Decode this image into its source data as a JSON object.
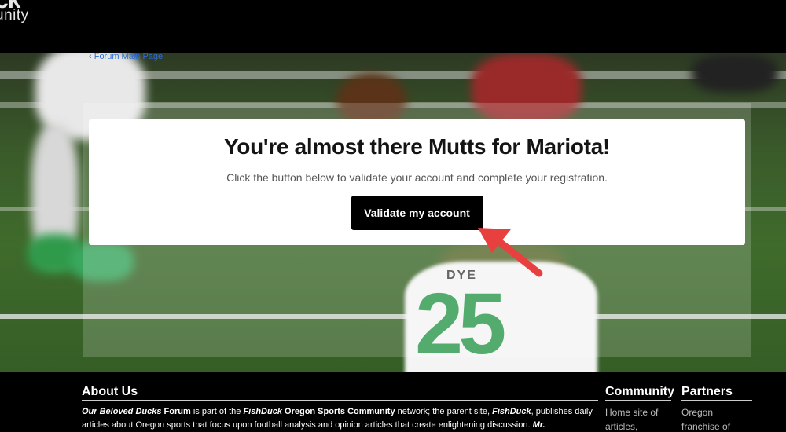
{
  "header": {
    "logo_line1": "ck",
    "logo_line2": "unity"
  },
  "nav": {
    "back_link": "‹ Forum Main Page"
  },
  "card": {
    "title": "You're almost there Mutts for Mariota!",
    "message": "Click the button below to validate your account and complete your registration.",
    "button_label": "Validate my account"
  },
  "photo": {
    "jersey_name": "DYE",
    "jersey_number": "25"
  },
  "footer": {
    "about": {
      "heading": "About Us",
      "text_parts": [
        "Our Beloved Ducks",
        " ",
        "Forum",
        " is part of the ",
        "FishDuck",
        " ",
        "Oregon Sports Community",
        " network; the parent site, ",
        "FishDuck",
        ", publishes daily articles about Oregon sports that focus upon football analysis and opinion articles that create enlightening discussion. ",
        "Mr."
      ]
    },
    "community": {
      "heading": "Community",
      "text": "Home site of articles,"
    },
    "partners": {
      "heading": "Partners",
      "text": "Oregon franchise of"
    }
  },
  "colors": {
    "button_bg": "#000000",
    "arrow": "#e8403f",
    "link": "#2f6fd6"
  }
}
